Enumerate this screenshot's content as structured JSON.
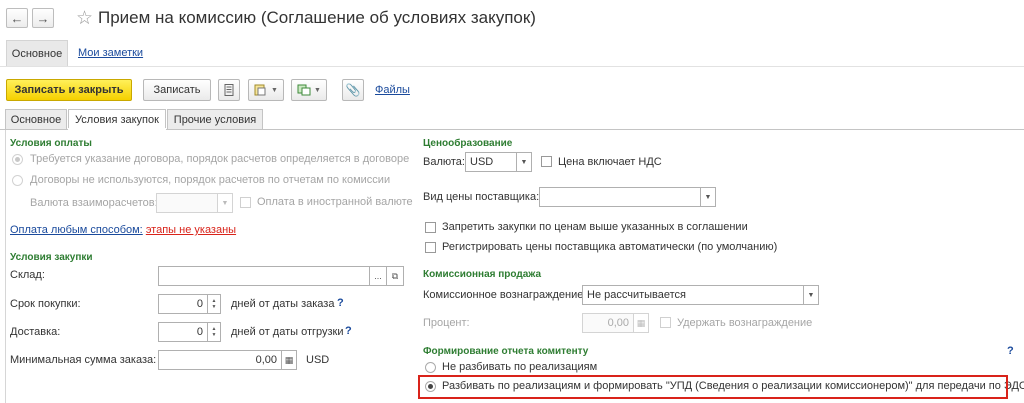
{
  "window": {
    "title": "Прием на комиссию (Соглашение об условиях закупок)"
  },
  "nav": {
    "back_icon": "arrow-left-icon",
    "forward_icon": "arrow-right-icon",
    "favorite_icon": "star-icon"
  },
  "top_tabs": {
    "main": "Основное",
    "notes": "Мои заметки"
  },
  "toolbar": {
    "save_close": "Записать и закрыть",
    "save": "Записать",
    "files": "Файлы"
  },
  "tabs": [
    {
      "label": "Основное"
    },
    {
      "label": "Условия закупок"
    },
    {
      "label": "Прочие условия"
    }
  ],
  "payment": {
    "section": "Условия оплаты",
    "opt1": "Требуется указание договора, порядок расчетов определяется в договоре",
    "opt2": "Договоры не используются, порядок расчетов по отчетам по комиссии",
    "currency_label": "Валюта взаиморасчетов:",
    "currency_value": "",
    "foreign_currency": "Оплата в иностранной валюте",
    "pay_link": "Оплата любым способом:",
    "pay_warning": "этапы не указаны"
  },
  "purchase": {
    "section": "Условия закупки",
    "warehouse_label": "Склад:",
    "warehouse_value": "",
    "term_label": "Срок покупки:",
    "term_value": "0",
    "term_suffix": "дней от даты заказа",
    "delivery_label": "Доставка:",
    "delivery_value": "0",
    "delivery_suffix": "дней от даты отгрузки",
    "min_label": "Минимальная сумма заказа:",
    "min_value": "0,00",
    "min_currency": "USD",
    "help": "?"
  },
  "pricing": {
    "section": "Ценообразование",
    "currency_label": "Валюта:",
    "currency_value": "USD",
    "vat_included": "Цена включает НДС",
    "price_type_label": "Вид цены поставщика:",
    "price_type_value": "",
    "forbid": "Запретить закупки по ценам выше указанных в соглашении",
    "register": "Регистрировать цены поставщика автоматически (по умолчанию)"
  },
  "commission": {
    "section": "Комиссионная продажа",
    "reward_label": "Комиссионное вознаграждение:",
    "reward_value": "Не рассчитывается",
    "percent_label": "Процент:",
    "percent_value": "0,00",
    "withhold": "Удержать вознаграждение"
  },
  "report": {
    "section": "Формирование отчета комитенту",
    "opt1": "Не разбивать по реализациям",
    "opt2": "Разбивать по реализациям и формировать \"УПД  (Сведения о реализации комиссионером)\" для передачи по ЭДО",
    "help": "?",
    "selected": 2
  },
  "colors": {
    "accent_green": "#2e7d32",
    "primary_button": "#f5d000",
    "link": "#1a4a9c",
    "highlight": "#d9231a"
  }
}
